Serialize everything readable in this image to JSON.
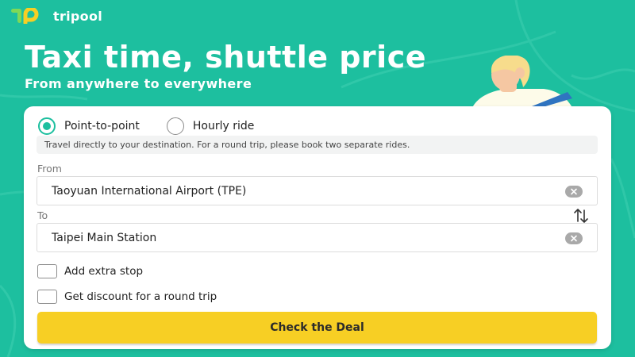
{
  "brand": {
    "name": "tripool",
    "logo_icon": "tripool-logo",
    "logo_colors": [
      "#7ed957",
      "#f7cf24"
    ]
  },
  "hero": {
    "title": "Taxi time, shuttle price",
    "subtitle": "From anywhere to everywhere"
  },
  "colors": {
    "background": "#1dbf9f",
    "accent": "#1dbf9f",
    "cta": "#f7cf24",
    "card": "#ffffff"
  },
  "booking": {
    "ride_types": [
      {
        "label": "Point-to-point",
        "selected": true
      },
      {
        "label": "Hourly ride",
        "selected": false
      }
    ],
    "info": "Travel directly to your destination. For a round trip, please book two separate rides.",
    "from": {
      "label": "From",
      "value": "Taoyuan International Airport (TPE)",
      "clear_icon": "close-icon"
    },
    "to": {
      "label": "To",
      "value": "Taipei Main Station",
      "clear_icon": "close-icon"
    },
    "swap_icon": "swap-vertical-icon",
    "options": [
      {
        "label": "Add extra stop",
        "checked": false
      },
      {
        "label": "Get discount for a round trip",
        "checked": false
      }
    ],
    "cta_label": "Check the Deal"
  }
}
